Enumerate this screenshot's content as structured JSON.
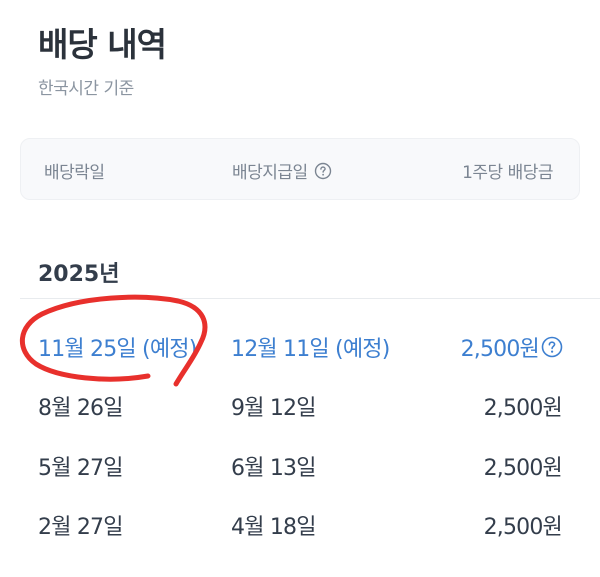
{
  "page": {
    "title": "배당 내역",
    "subtitle": "한국시간 기준"
  },
  "table": {
    "headers": {
      "ex_date": "배당락일",
      "pay_date": "배당지급일",
      "amount": "1주당 배당금"
    },
    "year_label": "2025년",
    "rows": [
      {
        "ex_date": "11월 25일 (예정)",
        "pay_date": "12월 11일 (예정)",
        "amount": "2,500원",
        "upcoming": true
      },
      {
        "ex_date": "8월 26일",
        "pay_date": "9월 12일",
        "amount": "2,500원",
        "upcoming": false
      },
      {
        "ex_date": "5월 27일",
        "pay_date": "6월 13일",
        "amount": "2,500원",
        "upcoming": false
      },
      {
        "ex_date": "2월 27일",
        "pay_date": "4월 18일",
        "amount": "2,500원",
        "upcoming": false
      }
    ]
  },
  "icons": {
    "header_help": "question-circle-icon",
    "amount_help": "question-circle-icon",
    "annotation": "red-hand-drawn-circle"
  },
  "colors": {
    "upcoming_text": "#3d7fd0",
    "annotation": "#e8302c",
    "header_bg": "#f8f9fb"
  }
}
